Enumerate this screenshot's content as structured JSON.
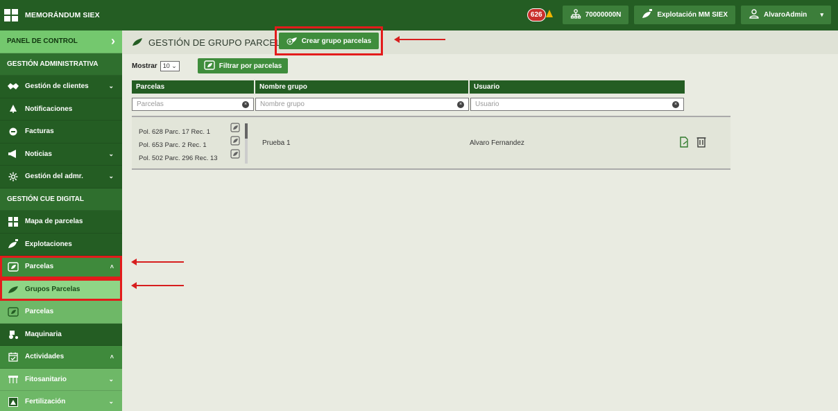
{
  "app": {
    "title": "MEMORÁNDUM SIEX"
  },
  "topbar": {
    "notifications_count": "626",
    "nif_label": "70000000N",
    "exploitation_label": "Explotación MM SIEX",
    "user_label": "AlvaroAdmin"
  },
  "sidebar": {
    "panel": "PANEL DE CONTROL",
    "section_admin": "GESTIÓN ADMINISTRATIVA",
    "clients": "Gestión de clientes",
    "notifications": "Notificaciones",
    "invoices": "Facturas",
    "news": "Noticias",
    "admin_mgmt": "Gestión del admr.",
    "section_cue": "GESTIÓN CUE DIGITAL",
    "map": "Mapa de parcelas",
    "exploitations": "Explotaciones",
    "parcels_group": "Parcelas",
    "parcel_groups": "Grupos Parcelas",
    "parcels": "Parcelas",
    "machinery": "Maquinaria",
    "activities": "Actividades",
    "phytosanitary": "Fitosanitario",
    "fertilization": "Fertilización"
  },
  "main": {
    "title": "GESTIÓN DE GRUPO PARCELAS",
    "create_button": "Crear grupo parcelas",
    "show_label": "Mostrar",
    "page_size": "10",
    "filter_button": "Filtrar por parcelas"
  },
  "table": {
    "headers": [
      "Parcelas",
      "Nombre grupo",
      "Usuario"
    ],
    "filter_placeholders": [
      "Parcelas",
      "Nombre grupo",
      "Usuario"
    ],
    "rows": [
      {
        "parcels": [
          "Pol. 628 Parc. 17 Rec. 1",
          "Pol. 653 Parc. 2 Rec. 1",
          "Pol. 502 Parc. 296 Rec. 13"
        ],
        "name": "Prueba 1",
        "user": "Alvaro Fernandez"
      }
    ]
  },
  "colors": {
    "primary": "#245d23",
    "accent": "#3f8d3c",
    "highlight": "#e31b1b",
    "background": "#e9ebe1"
  }
}
